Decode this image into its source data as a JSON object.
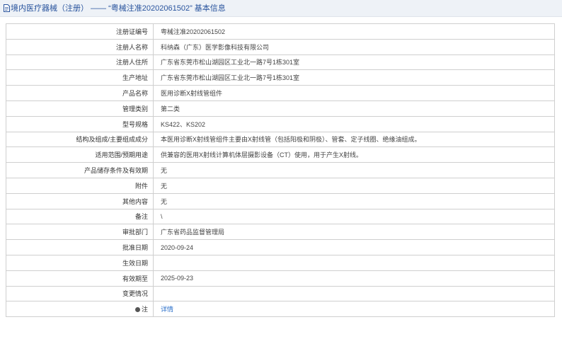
{
  "header": {
    "title": "境内医疗器械（注册） —— “粤械注准20202061502” 基本信息"
  },
  "rows": [
    {
      "label": "注册证编号",
      "value": "粤械注准20202061502"
    },
    {
      "label": "注册人名称",
      "value": "科纳森（广东）医学影像科技有限公司"
    },
    {
      "label": "注册人住所",
      "value": "广东省东莞市松山湖园区工业北一路7号1栋301室"
    },
    {
      "label": "生产地址",
      "value": "广东省东莞市松山湖园区工业北一路7号1栋301室"
    },
    {
      "label": "产品名称",
      "value": "医用诊断X射线管组件"
    },
    {
      "label": "管理类别",
      "value": "第二类"
    },
    {
      "label": "型号规格",
      "value": "KS422、KS202"
    },
    {
      "label": "结构及组成/主要组成成分",
      "value": "本医用诊断X射线管组件主要由X射线管（包括阳极和阴极）、管套、定子线圈、绝缘油组成。"
    },
    {
      "label": "适用范围/预期用途",
      "value": "供兼容的医用X射线计算机体层摄影设备（CT）使用，用于产生X射线。"
    },
    {
      "label": "产品储存条件及有效期",
      "value": "无"
    },
    {
      "label": "附件",
      "value": "无"
    },
    {
      "label": "其他内容",
      "value": "无"
    },
    {
      "label": "备注",
      "value": "\\"
    },
    {
      "label": "审批部门",
      "value": "广东省药品监督管理局"
    },
    {
      "label": "批准日期",
      "value": "2020-09-24"
    },
    {
      "label": "生效日期",
      "value": ""
    },
    {
      "label": "有效期至",
      "value": "2025-09-23"
    },
    {
      "label": "变更情况",
      "value": ""
    }
  ],
  "note_row": {
    "label": "注",
    "link_text": "详情"
  }
}
